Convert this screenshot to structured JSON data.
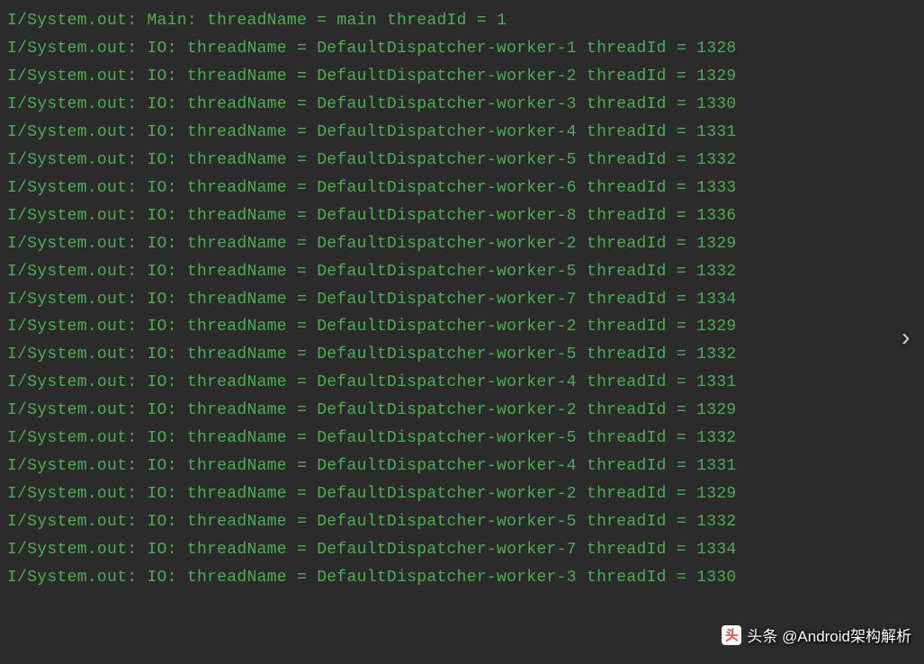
{
  "logs": [
    {
      "prefix": "I/System.out:",
      "dispatcher": "Main:",
      "threadName": "main",
      "threadId": "1"
    },
    {
      "prefix": "I/System.out:",
      "dispatcher": "IO:",
      "threadName": "DefaultDispatcher-worker-1",
      "threadId": "1328"
    },
    {
      "prefix": "I/System.out:",
      "dispatcher": "IO:",
      "threadName": "DefaultDispatcher-worker-2",
      "threadId": "1329"
    },
    {
      "prefix": "I/System.out:",
      "dispatcher": "IO:",
      "threadName": "DefaultDispatcher-worker-3",
      "threadId": "1330"
    },
    {
      "prefix": "I/System.out:",
      "dispatcher": "IO:",
      "threadName": "DefaultDispatcher-worker-4",
      "threadId": "1331"
    },
    {
      "prefix": "I/System.out:",
      "dispatcher": "IO:",
      "threadName": "DefaultDispatcher-worker-5",
      "threadId": "1332"
    },
    {
      "prefix": "I/System.out:",
      "dispatcher": "IO:",
      "threadName": "DefaultDispatcher-worker-6",
      "threadId": "1333"
    },
    {
      "prefix": "I/System.out:",
      "dispatcher": "IO:",
      "threadName": "DefaultDispatcher-worker-8",
      "threadId": "1336"
    },
    {
      "prefix": "I/System.out:",
      "dispatcher": "IO:",
      "threadName": "DefaultDispatcher-worker-2",
      "threadId": "1329"
    },
    {
      "prefix": "I/System.out:",
      "dispatcher": "IO:",
      "threadName": "DefaultDispatcher-worker-5",
      "threadId": "1332"
    },
    {
      "prefix": "I/System.out:",
      "dispatcher": "IO:",
      "threadName": "DefaultDispatcher-worker-7",
      "threadId": "1334"
    },
    {
      "prefix": "I/System.out:",
      "dispatcher": "IO:",
      "threadName": "DefaultDispatcher-worker-2",
      "threadId": "1329"
    },
    {
      "prefix": "I/System.out:",
      "dispatcher": "IO:",
      "threadName": "DefaultDispatcher-worker-5",
      "threadId": "1332"
    },
    {
      "prefix": "I/System.out:",
      "dispatcher": "IO:",
      "threadName": "DefaultDispatcher-worker-4",
      "threadId": "1331"
    },
    {
      "prefix": "I/System.out:",
      "dispatcher": "IO:",
      "threadName": "DefaultDispatcher-worker-2",
      "threadId": "1329"
    },
    {
      "prefix": "I/System.out:",
      "dispatcher": "IO:",
      "threadName": "DefaultDispatcher-worker-5",
      "threadId": "1332"
    },
    {
      "prefix": "I/System.out:",
      "dispatcher": "IO:",
      "threadName": "DefaultDispatcher-worker-4",
      "threadId": "1331"
    },
    {
      "prefix": "I/System.out:",
      "dispatcher": "IO:",
      "threadName": "DefaultDispatcher-worker-2",
      "threadId": "1329"
    },
    {
      "prefix": "I/System.out:",
      "dispatcher": "IO:",
      "threadName": "DefaultDispatcher-worker-5",
      "threadId": "1332"
    },
    {
      "prefix": "I/System.out:",
      "dispatcher": "IO:",
      "threadName": "DefaultDispatcher-worker-7",
      "threadId": "1334"
    },
    {
      "prefix": "I/System.out:",
      "dispatcher": "IO:",
      "threadName": "DefaultDispatcher-worker-3",
      "threadId": "1330"
    }
  ],
  "labels": {
    "threadNameLabel": "threadName =",
    "threadIdLabel": "threadId ="
  },
  "watermark": {
    "iconText": "头",
    "label": "头条 @Android架构解析"
  },
  "nextArrow": "›"
}
